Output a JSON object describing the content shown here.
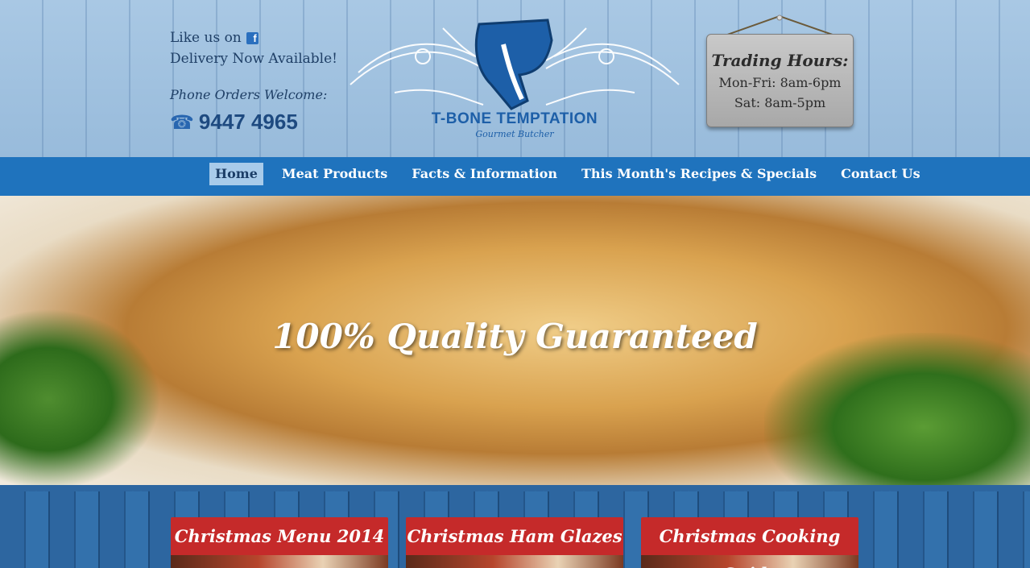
{
  "header": {
    "like_text": "Like us on",
    "facebook_icon": "facebook-icon",
    "delivery": "Delivery Now Available!",
    "phone_label": "Phone Orders Welcome:",
    "phone_icon": "phone-icon",
    "phone_number": "9447 4965"
  },
  "logo": {
    "brand": "T-BONE TEMPTATION",
    "subtitle": "Gourmet Butcher"
  },
  "hours": {
    "title": "Trading Hours:",
    "weekday": "Mon-Fri: 8am-6pm",
    "saturday": "Sat: 8am-5pm"
  },
  "nav": {
    "items": [
      {
        "label": "Home",
        "active": true
      },
      {
        "label": "Meat Products"
      },
      {
        "label": "Facts & Information"
      },
      {
        "label": "This Month's Recipes & Specials"
      },
      {
        "label": "Contact Us"
      }
    ]
  },
  "hero": {
    "headline": "100% Quality Guaranteed"
  },
  "cards": [
    {
      "title": "Christmas Menu 2014"
    },
    {
      "title": "Christmas Ham Glazes"
    },
    {
      "title": "Christmas Cooking Guide"
    }
  ],
  "colors": {
    "nav": "#1f73bd",
    "card": "#c52a2a",
    "header_bg": "#a9c8e4"
  }
}
